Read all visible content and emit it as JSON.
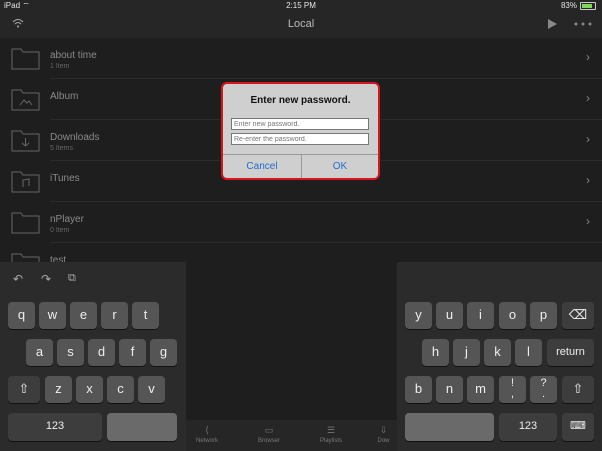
{
  "status": {
    "device": "iPad",
    "time": "2:15 PM",
    "battery": "83%"
  },
  "nav": {
    "title": "Local"
  },
  "list": [
    {
      "name": "about time",
      "sub": "1 Item"
    },
    {
      "name": "Album",
      "sub": ""
    },
    {
      "name": "Downloads",
      "sub": "5 Items"
    },
    {
      "name": "iTunes",
      "sub": ""
    },
    {
      "name": "nPlayer",
      "sub": "0 Item"
    },
    {
      "name": "test",
      "sub": ""
    }
  ],
  "dialog": {
    "title": "Enter new password.",
    "field1_placeholder": "Enter new password.",
    "field2_placeholder": "Re-enter the password.",
    "cancel": "Cancel",
    "ok": "OK"
  },
  "keyboard": {
    "left_row1": [
      "q",
      "w",
      "e",
      "r",
      "t"
    ],
    "left_row2": [
      "a",
      "s",
      "d",
      "f",
      "g"
    ],
    "left_row3": [
      "z",
      "x",
      "c",
      "v"
    ],
    "right_row1": [
      "y",
      "u",
      "i",
      "o",
      "p"
    ],
    "right_row2": [
      "h",
      "j",
      "k",
      "l"
    ],
    "right_row3": [
      "b",
      "n",
      "m",
      "!\n,",
      "?\n."
    ],
    "return": "return",
    "numbers_left": "123",
    "numbers_right": "123"
  },
  "tabs": [
    "Network",
    "Browser",
    "Playlists",
    "Dow"
  ],
  "colors": {
    "accent": "#1f6fd1",
    "highlight": "#d9141c",
    "battery": "#7ed957"
  }
}
